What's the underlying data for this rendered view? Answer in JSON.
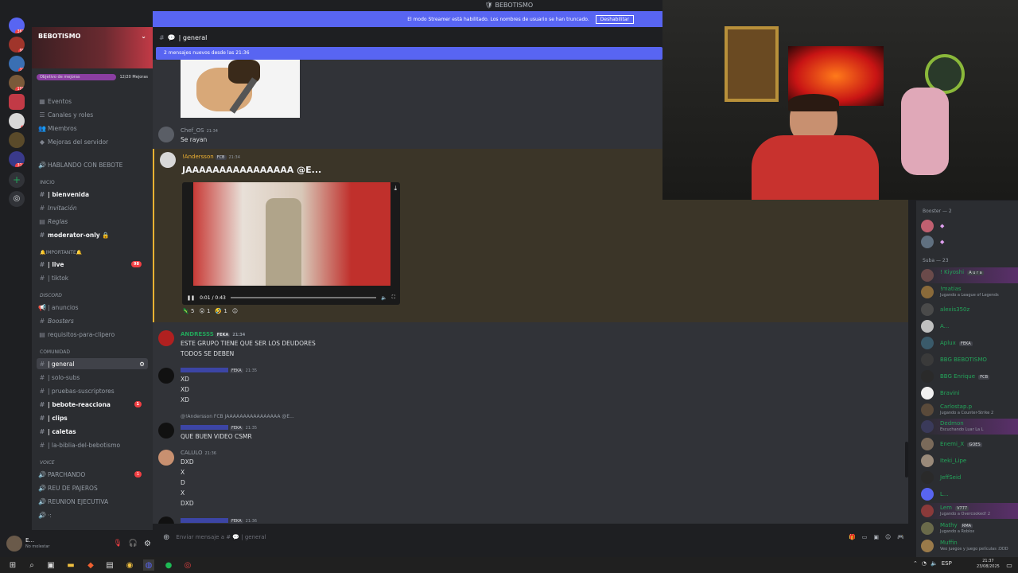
{
  "window": {
    "title": "BEBOTISMO"
  },
  "servers": [
    {
      "badge": "361"
    },
    {
      "badge": "99"
    },
    {
      "badge": "12"
    },
    {
      "badge": "100"
    },
    {
      "badge": ""
    },
    {
      "badge": "6"
    },
    {
      "badge": ""
    },
    {
      "badge": "314"
    }
  ],
  "server": {
    "name": "BEBOTISMO",
    "boost_goal": "Objetivo de mejoras",
    "boost_progress": "12/20 Mejoras",
    "menu": [
      "Eventos",
      "Canales y roles",
      "Miembros",
      "Mejoras del servidor"
    ],
    "hablando": "HABLANDO CON BEBOTE"
  },
  "categories": [
    {
      "name": "INICIO",
      "channels": [
        {
          "label": "| bienvenida",
          "bold": true
        },
        {
          "label": "Invitación",
          "italic": true
        },
        {
          "label": "Reglas",
          "italic": true
        },
        {
          "label": "moderator-only 🔒",
          "bold": true
        }
      ]
    },
    {
      "name": "🔔IMPORTANTE🔔",
      "channels": [
        {
          "label": "| live",
          "bold": true,
          "count": "98"
        },
        {
          "label": "| tiktok"
        }
      ]
    },
    {
      "name": "DISCORD",
      "channels": [
        {
          "label": "| anuncios"
        },
        {
          "label": "Boosters",
          "italic": true
        },
        {
          "label": "requisitos-para-clipero"
        }
      ]
    },
    {
      "name": "COMUNIDAD",
      "channels": [
        {
          "label": "| general",
          "active": true
        },
        {
          "label": "| solo-subs"
        },
        {
          "label": "| pruebas-suscriptores"
        },
        {
          "label": "| bebote-reacciona",
          "bold": true,
          "count": "1"
        },
        {
          "label": "| clips",
          "bold": true
        },
        {
          "label": "| caletas",
          "bold": true
        },
        {
          "label": "| la-biblia-del-bebotismo"
        }
      ]
    },
    {
      "name": "VOICE",
      "channels": [
        {
          "label": "PARCHANDO",
          "count": "1"
        },
        {
          "label": "REU DE PAJEROS"
        },
        {
          "label": "REUNION EJECUTIVA"
        },
        {
          "label": "·:"
        }
      ]
    }
  ],
  "user": {
    "name": "E...",
    "status": "No molestar"
  },
  "streamer": {
    "notice": "El modo Streamer está habilitado. Los nombres de usuario se han truncado.",
    "button": "Deshabilitar"
  },
  "channel": {
    "name": "| general"
  },
  "new_messages": "2 mensajes nuevos desde las 21:36",
  "messages": [
    {
      "user": "Chef_OS",
      "time": "21:34",
      "lines": [
        "Se rayan"
      ]
    },
    {
      "user": "!Andersson",
      "tag": "FCB",
      "time": "21:34",
      "lines": [
        "JAAAAAAAAAAAAAAAA @E..."
      ],
      "video": {
        "time": "0:01 / 0:43"
      },
      "reactions": [
        "5",
        "1",
        "1"
      ]
    },
    {
      "user": "ANDRESSS",
      "tag": "FEKA",
      "time": "21:34",
      "lines": [
        "ESTE GRUPO TIENE QUE SER LOS DEUDORES",
        "TODOS SE DEBEN"
      ]
    },
    {
      "user": "",
      "tag": "FEKA",
      "time": "21:35",
      "lines": [
        "XD",
        "XD",
        "XD"
      ]
    },
    {
      "user": "",
      "tag": "FEKA",
      "time": "21:35",
      "reply": "@!Andersson  FCB  JAAAAAAAAAAAAAAAA @E...",
      "lines": [
        "QUE BUEN VIDEO CSMR"
      ]
    },
    {
      "user": "CALULO",
      "time": "21:36",
      "lines": [
        "DXD",
        "X",
        "D",
        "X",
        "DXD"
      ]
    },
    {
      "user": "",
      "tag": "FEKA",
      "time": "21:36",
      "lines": []
    }
  ],
  "composer": {
    "placeholder": "Enviar mensaje a # 💬 | general"
  },
  "members": {
    "booster_header": "Booster — 2",
    "suba_header": "Suba — 23",
    "list": [
      {
        "name": "! Kiyoshi",
        "badge": "A u r a",
        "status": ""
      },
      {
        "name": "!matias",
        "status": "Jugando a League of Legends"
      },
      {
        "name": "alexis350z",
        "status": ""
      },
      {
        "name": "A...",
        "status": ""
      },
      {
        "name": "Aplux",
        "badge": "FEKA",
        "status": ""
      },
      {
        "name": "BBG BEBOTISMO",
        "status": ""
      },
      {
        "name": "BBG Enrique",
        "badge": "FCB",
        "status": ""
      },
      {
        "name": "Bravini",
        "status": ""
      },
      {
        "name": "Carlostap.p",
        "status": "Jugando a Counter-Strike 2"
      },
      {
        "name": "Dedmon",
        "status": "Escuchando Luar La L"
      },
      {
        "name": "Enemi_X",
        "badge": "GOES",
        "status": ""
      },
      {
        "name": "Iteki_Lipe",
        "status": ""
      },
      {
        "name": "JeffSeid",
        "status": ""
      },
      {
        "name": "L...",
        "status": ""
      },
      {
        "name": "Lem",
        "badge": "V777",
        "status": "Jugando a Overcooked! 2"
      },
      {
        "name": "Mathy",
        "badge": "RMA",
        "status": "Jugando a Roblox"
      },
      {
        "name": "Muffin",
        "status": "Veo juegos y juego películas :DDD"
      }
    ]
  },
  "taskbar": {
    "lang": "ESP",
    "time": "21:37",
    "date": "23/08/2025"
  }
}
